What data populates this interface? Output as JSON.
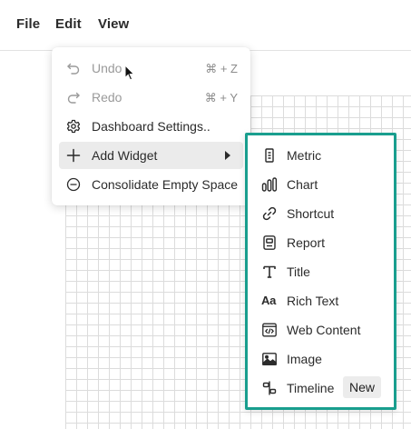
{
  "menubar": {
    "file": "File",
    "edit": "Edit",
    "view": "View"
  },
  "edit_menu": {
    "items": [
      {
        "label": "Undo",
        "shortcut": "⌘ + Z",
        "icon": "undo-icon",
        "disabled": true
      },
      {
        "label": "Redo",
        "shortcut": "⌘ + Y",
        "icon": "redo-icon",
        "disabled": true
      },
      {
        "label": "Dashboard Settings..",
        "icon": "gear-icon"
      },
      {
        "label": "Add Widget",
        "icon": "plus-icon",
        "active": true,
        "has_submenu": true
      },
      {
        "label": "Consolidate Empty Space",
        "icon": "minus-circle-icon"
      }
    ]
  },
  "widget_submenu": {
    "accent_color": "#199e8e",
    "items": [
      {
        "label": "Metric",
        "icon": "metric-icon"
      },
      {
        "label": "Chart",
        "icon": "bar-chart-icon"
      },
      {
        "label": "Shortcut",
        "icon": "link-icon"
      },
      {
        "label": "Report",
        "icon": "report-icon"
      },
      {
        "label": "Title",
        "icon": "title-icon"
      },
      {
        "label": "Rich Text",
        "icon": "rich-text-icon",
        "glyph": "Aa"
      },
      {
        "label": "Web Content",
        "icon": "web-content-icon"
      },
      {
        "label": "Image",
        "icon": "image-icon"
      },
      {
        "label": "Timeline",
        "icon": "timeline-icon",
        "badge": "New"
      }
    ]
  }
}
